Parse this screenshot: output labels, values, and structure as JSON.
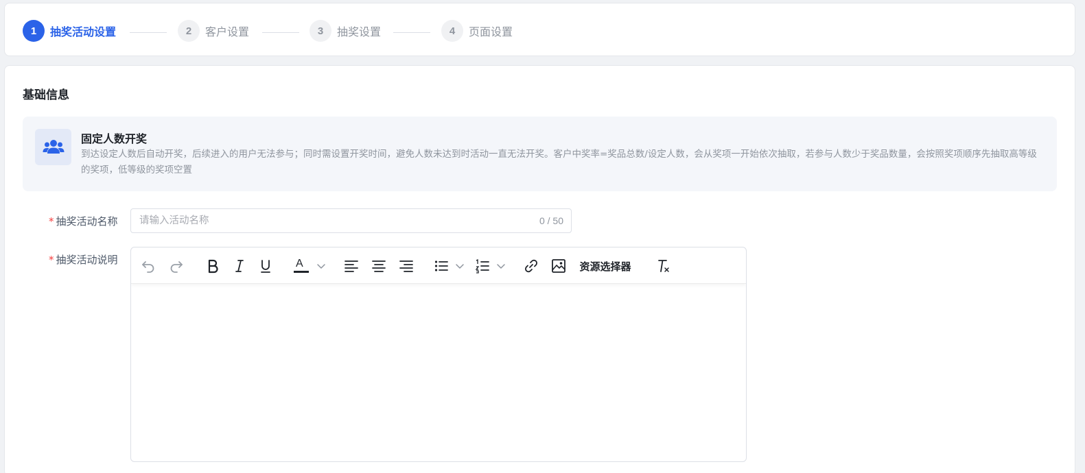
{
  "steps": [
    {
      "num": "1",
      "label": "抽奖活动设置",
      "active": true
    },
    {
      "num": "2",
      "label": "客户设置",
      "active": false
    },
    {
      "num": "3",
      "label": "抽奖设置",
      "active": false
    },
    {
      "num": "4",
      "label": "页面设置",
      "active": false
    }
  ],
  "section_title": "基础信息",
  "info": {
    "icon": "users-group-icon",
    "title": "固定人数开奖",
    "description": "到达设定人数后自动开奖，后续进入的用户无法参与；同时需设置开奖时间，避免人数未达到时活动一直无法开奖。客户中奖率=奖品总数/设定人数，会从奖项一开始依次抽取，若参与人数少于奖品数量，会按照奖项顺序先抽取高等级的奖项，低等级的奖项空置"
  },
  "form": {
    "name_label": "抽奖活动名称",
    "name_placeholder": "请输入活动名称",
    "name_value": "",
    "name_counter": "0 / 50",
    "desc_label": "抽奖活动说明",
    "required_mark": "*"
  },
  "toolbar": {
    "resource_selector": "资源选择器",
    "font_color_letter": "A"
  },
  "colors": {
    "accent": "#2b63e8",
    "required": "#f53f3f",
    "muted": "#8f959e"
  }
}
